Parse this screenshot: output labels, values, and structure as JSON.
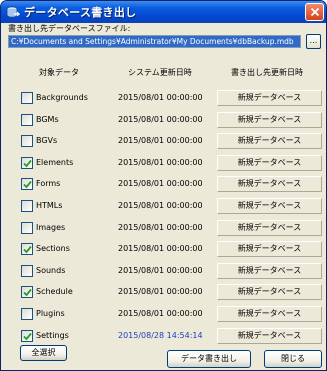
{
  "window": {
    "title": "データベース書き出し",
    "icon": "database-export-icon"
  },
  "path": {
    "label": "書き出し先データベースファイル:",
    "value": "C:¥Documents and Settings¥Administrator¥My Documents¥dbBackup.mdb",
    "browse_label": "..."
  },
  "table": {
    "headers": {
      "target": "対象データ",
      "system": "システム更新日時",
      "dest": "書き出し先更新日時"
    },
    "rows": [
      {
        "name": "Backgrounds",
        "checked": false,
        "sysdate": "2015/08/01 00:00:00",
        "dest": "新規データベース",
        "updated": false
      },
      {
        "name": "BGMs",
        "checked": false,
        "sysdate": "2015/08/01 00:00:00",
        "dest": "新規データベース",
        "updated": false
      },
      {
        "name": "BGVs",
        "checked": false,
        "sysdate": "2015/08/01 00:00:00",
        "dest": "新規データベース",
        "updated": false
      },
      {
        "name": "Elements",
        "checked": true,
        "sysdate": "2015/08/01 00:00:00",
        "dest": "新規データベース",
        "updated": false
      },
      {
        "name": "Forms",
        "checked": true,
        "sysdate": "2015/08/01 00:00:00",
        "dest": "新規データベース",
        "updated": false
      },
      {
        "name": "HTMLs",
        "checked": false,
        "sysdate": "2015/08/01 00:00:00",
        "dest": "新規データベース",
        "updated": false
      },
      {
        "name": "Images",
        "checked": false,
        "sysdate": "2015/08/01 00:00:00",
        "dest": "新規データベース",
        "updated": false
      },
      {
        "name": "Sections",
        "checked": true,
        "sysdate": "2015/08/01 00:00:00",
        "dest": "新規データベース",
        "updated": false
      },
      {
        "name": "Sounds",
        "checked": false,
        "sysdate": "2015/08/01 00:00:00",
        "dest": "新規データベース",
        "updated": false
      },
      {
        "name": "Schedule",
        "checked": true,
        "sysdate": "2015/08/01 00:00:00",
        "dest": "新規データベース",
        "updated": false
      },
      {
        "name": "Plugins",
        "checked": false,
        "sysdate": "2015/08/01 00:00:00",
        "dest": "新規データベース",
        "updated": false
      },
      {
        "name": "Settings",
        "checked": true,
        "sysdate": "2015/08/28 14:54:14",
        "dest": "新規データベース",
        "updated": true
      }
    ]
  },
  "buttons": {
    "select_all": "全選択",
    "export": "データ書き出し",
    "close": "閉じる"
  },
  "colors": {
    "titlebar": "#0347d1",
    "path_selection": "#316ac5",
    "updated_date": "#1f3fbf",
    "close_button": "#d4421c",
    "check": "#21a121"
  }
}
